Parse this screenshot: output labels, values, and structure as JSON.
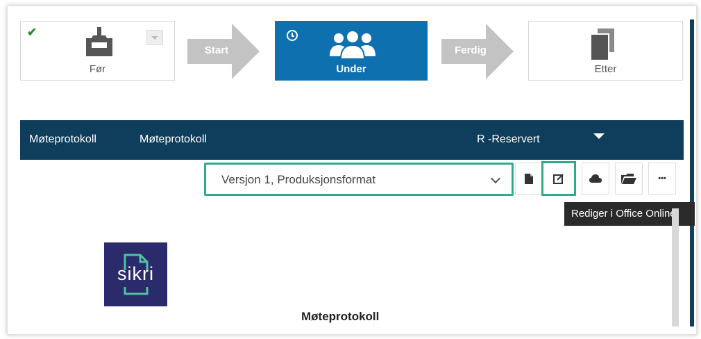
{
  "steps": {
    "before": {
      "label": "Før"
    },
    "start_arrow": "Start",
    "during": {
      "label": "Under"
    },
    "finish_arrow": "Ferdig",
    "after": {
      "label": "Etter"
    }
  },
  "doc_bar": {
    "type": "Møteprotokoll",
    "title": "Møteprotokoll",
    "access": "R -Reservert"
  },
  "toolbar": {
    "version_select": "Versjon 1, Produksjonsformat",
    "tooltip": "Rediger i Office Online",
    "more_label": "•••"
  },
  "document": {
    "logo_text": "sikri",
    "heading": "Møteprotokoll"
  },
  "colors": {
    "active_step": "#0f70b0",
    "header_bar": "#0f3d5c",
    "highlight": "#2eaa8e",
    "logo_bg": "#2b2a6b"
  }
}
